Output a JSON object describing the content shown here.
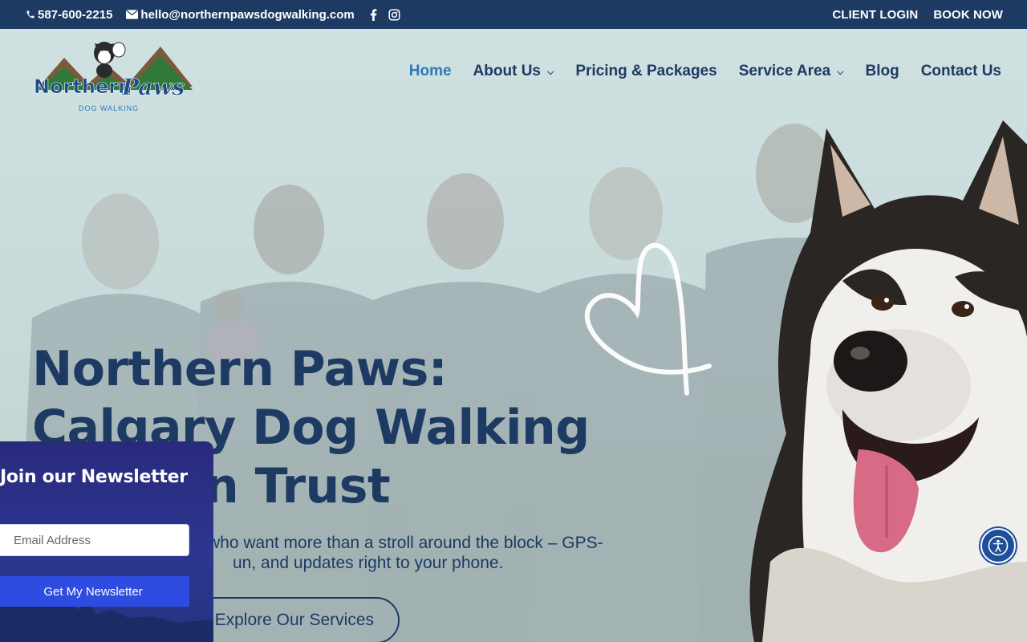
{
  "topbar": {
    "phone": "587-600-2215",
    "email": "hello@northernpawsdogwalking.com",
    "social": [
      "facebook-icon",
      "instagram-icon"
    ],
    "client_login": "CLIENT LOGIN",
    "book_now": "BOOK NOW"
  },
  "logo": {
    "line1": "Northern",
    "line2": "Paws",
    "tagline": "DOG WALKING"
  },
  "nav": {
    "items": [
      {
        "label": "Home",
        "active": true,
        "dropdown": false
      },
      {
        "label": "About Us",
        "active": false,
        "dropdown": true
      },
      {
        "label": "Pricing & Packages",
        "active": false,
        "dropdown": false
      },
      {
        "label": "Service Area",
        "active": false,
        "dropdown": true
      },
      {
        "label": "Blog",
        "active": false,
        "dropdown": false
      },
      {
        "label": "Contact Us",
        "active": false,
        "dropdown": false
      }
    ]
  },
  "hero": {
    "headline_line1": "Northern Paws:",
    "headline_line2": "Calgary Dog Walking",
    "headline_line3": "n Trust",
    "sub_line1": "who want more than a stroll around the block – GPS-",
    "sub_line2": "un, and updates right to your phone.",
    "cta_label": "Explore Our Services"
  },
  "newsletter": {
    "title": "Join our Newsletter",
    "email_placeholder": "Email Address",
    "submit_label": "Get My Newsletter"
  },
  "colors": {
    "navy": "#1d3a63",
    "active_link": "#2f79b5",
    "newsletter_bg": "#2a2a7c",
    "newsletter_button": "#2e4de0"
  }
}
